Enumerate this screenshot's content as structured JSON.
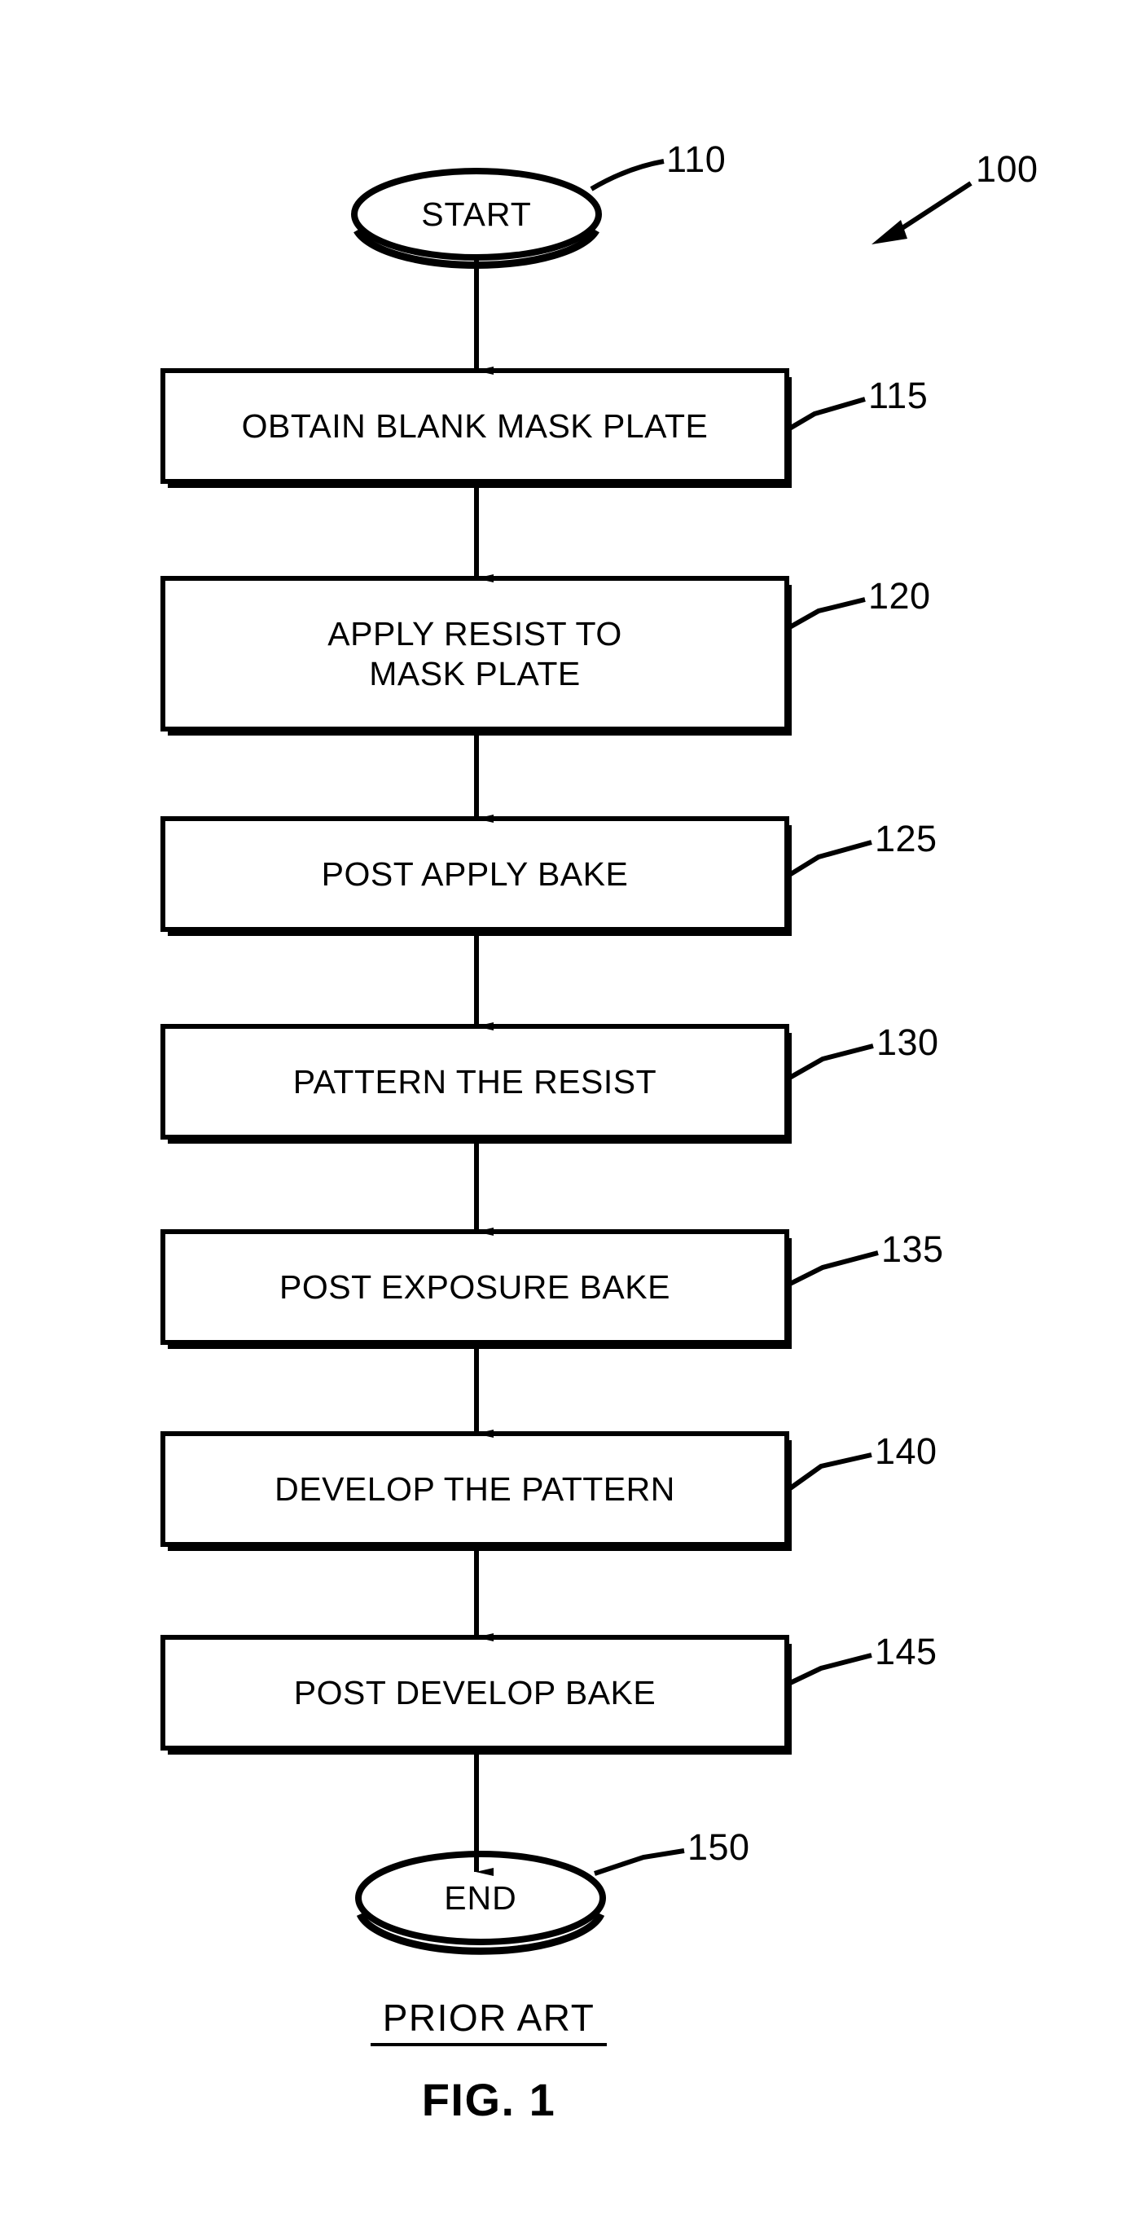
{
  "figure": {
    "diagram_reference": "100",
    "prior_art_caption": "PRIOR ART",
    "figure_caption": "FIG. 1",
    "line_color": "#000000",
    "background_color": "#ffffff"
  },
  "nodes": [
    {
      "id": "start",
      "shape": "terminator",
      "label": "START",
      "ref": "110"
    },
    {
      "id": "obtain-blank-mask-plate",
      "shape": "process",
      "label": "OBTAIN BLANK MASK PLATE",
      "ref": "115"
    },
    {
      "id": "apply-resist-to-mask-plate",
      "shape": "process",
      "label": "APPLY RESIST TO\nMASK PLATE",
      "ref": "120"
    },
    {
      "id": "post-apply-bake",
      "shape": "process",
      "label": "POST APPLY BAKE",
      "ref": "125"
    },
    {
      "id": "pattern-the-resist",
      "shape": "process",
      "label": "PATTERN THE RESIST",
      "ref": "130"
    },
    {
      "id": "post-exposure-bake",
      "shape": "process",
      "label": "POST EXPOSURE BAKE",
      "ref": "135"
    },
    {
      "id": "develop-the-pattern",
      "shape": "process",
      "label": "DEVELOP THE PATTERN",
      "ref": "140"
    },
    {
      "id": "post-develop-bake",
      "shape": "process",
      "label": "POST DEVELOP BAKE",
      "ref": "145"
    },
    {
      "id": "end",
      "shape": "terminator",
      "label": "END",
      "ref": "150"
    }
  ],
  "edges": [
    {
      "from": "start",
      "to": "obtain-blank-mask-plate"
    },
    {
      "from": "obtain-blank-mask-plate",
      "to": "apply-resist-to-mask-plate"
    },
    {
      "from": "apply-resist-to-mask-plate",
      "to": "post-apply-bake"
    },
    {
      "from": "post-apply-bake",
      "to": "pattern-the-resist"
    },
    {
      "from": "pattern-the-resist",
      "to": "post-exposure-bake"
    },
    {
      "from": "post-exposure-bake",
      "to": "develop-the-pattern"
    },
    {
      "from": "develop-the-pattern",
      "to": "post-develop-bake"
    },
    {
      "from": "post-develop-bake",
      "to": "end"
    }
  ]
}
